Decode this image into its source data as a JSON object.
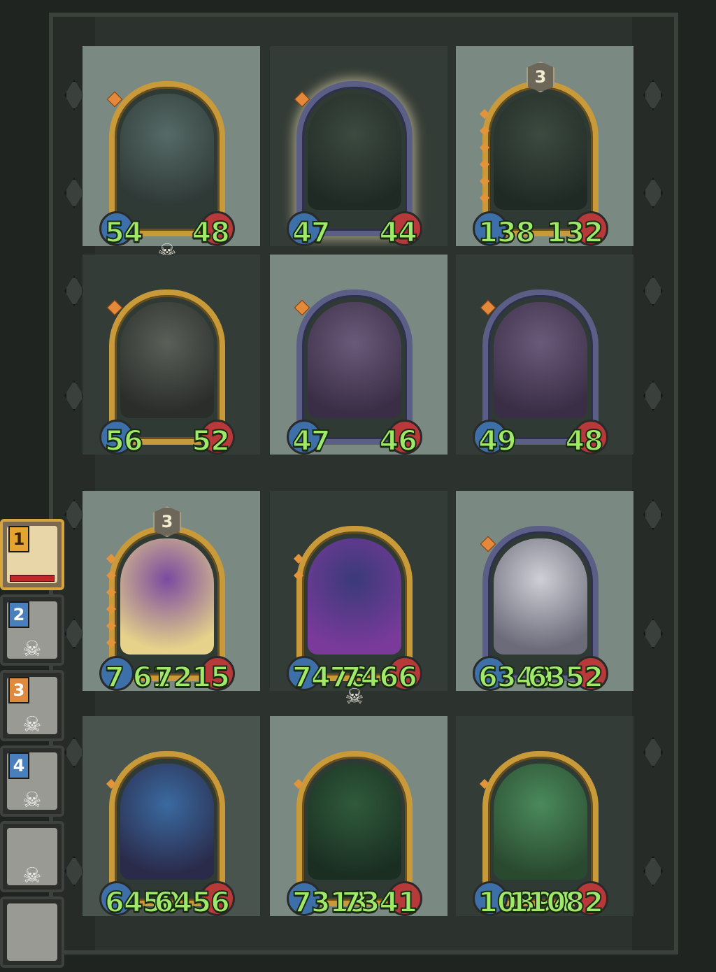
{
  "board": [
    {
      "atk": "54",
      "hp": "48",
      "theme": "chest",
      "frame": "gold",
      "skull": true,
      "stars": 0,
      "level_badge": ""
    },
    {
      "atk": "47",
      "hp": "44",
      "theme": "turret",
      "frame": "silver",
      "skull": false,
      "stars": 0,
      "level_badge": ""
    },
    {
      "atk": "138",
      "hp": "132",
      "theme": "turret",
      "frame": "gold",
      "skull": false,
      "stars": 6,
      "level_badge": "3"
    },
    {
      "atk": "56",
      "hp": "52",
      "theme": "robot",
      "frame": "gold",
      "skull": false,
      "stars": 0,
      "level_badge": ""
    },
    {
      "atk": "47",
      "hp": "46",
      "theme": "pink-girl",
      "frame": "silver",
      "skull": false,
      "stars": 0,
      "level_badge": ""
    },
    {
      "atk": "49",
      "hp": "48",
      "theme": "pink-girl",
      "frame": "silver",
      "skull": false,
      "stars": 0,
      "level_badge": ""
    },
    {
      "atk": "7 61",
      "hp": "7215",
      "theme": "elf-purple",
      "frame": "gold",
      "skull": false,
      "stars": 6,
      "level_badge": "3"
    },
    {
      "atk": "7476",
      "hp": "7466",
      "theme": "moon-mage",
      "frame": "gold",
      "skull": true,
      "stars": 2,
      "level_badge": ""
    },
    {
      "atk": "6349",
      "hp": "6352",
      "theme": "white-maiden",
      "frame": "silver",
      "skull": false,
      "stars": 0,
      "level_badge": ""
    },
    {
      "atk": "6450",
      "hp": "6456",
      "theme": "blue-elf",
      "frame": "gold",
      "skull": false,
      "stars": 1,
      "level_badge": ""
    },
    {
      "atk": "7313",
      "hp": "7341",
      "theme": "flute-player",
      "frame": "gold",
      "skull": false,
      "stars": 1,
      "level_badge": ""
    },
    {
      "atk": "10894",
      "hp": "11082",
      "theme": "forest-fairy",
      "frame": "gold",
      "skull": false,
      "stars": 1,
      "level_badge": ""
    }
  ],
  "party": [
    {
      "num": "1",
      "state": "active",
      "skull": false
    },
    {
      "num": "2",
      "state": "defeated",
      "skull": true
    },
    {
      "num": "3",
      "state": "defeated",
      "skull": true
    },
    {
      "num": "4",
      "state": "defeated",
      "skull": true
    },
    {
      "num": "",
      "state": "defeated",
      "skull": true
    },
    {
      "num": "",
      "state": "defeated",
      "skull": false
    }
  ],
  "colors": {
    "stat_text": "#9fe86a",
    "gold_frame": "#c99a3a",
    "silver_frame": "#5b5f86"
  },
  "icons": {
    "skull": "skull-icon"
  }
}
